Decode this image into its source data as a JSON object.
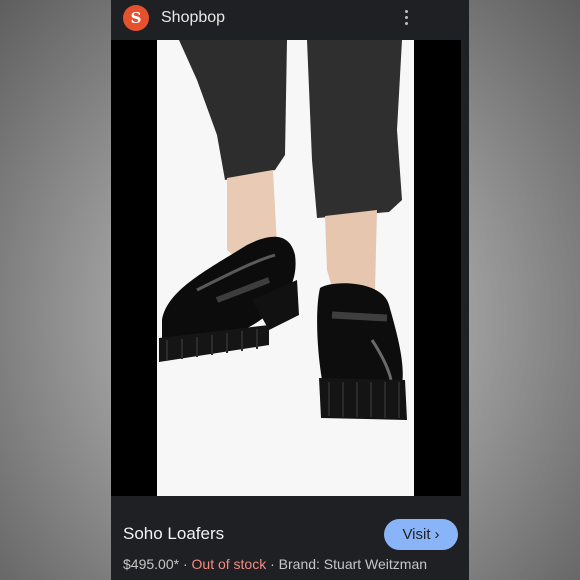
{
  "header": {
    "logo_letter": "S",
    "site_name": "Shopbop",
    "menu_icon": "more-vert-icon"
  },
  "product": {
    "title": "Soho Loafers",
    "price": "$495.00*",
    "stock_status": "Out of stock",
    "brand": "Brand: Stuart Weitzman",
    "separator": "·",
    "visit_label": "Visit",
    "visit_icon": "chevron-right-icon"
  },
  "colors": {
    "background": "#1f2023",
    "logo": "#e5512d",
    "visit_button": "#8ab4f8",
    "out_of_stock": "#f28b82"
  }
}
